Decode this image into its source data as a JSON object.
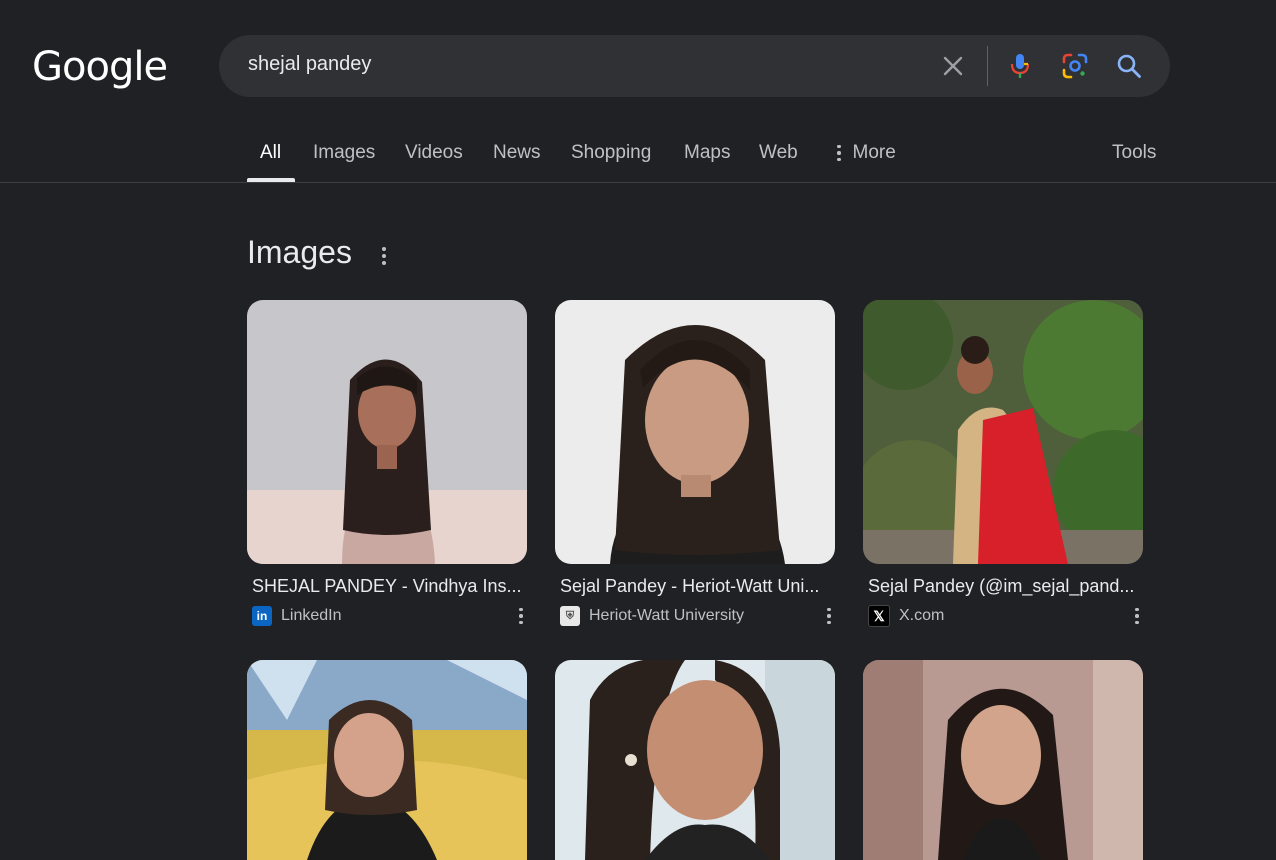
{
  "logo": "Google",
  "search": {
    "query": "shejal pandey"
  },
  "tabs": [
    {
      "label": "All",
      "active": true
    },
    {
      "label": "Images"
    },
    {
      "label": "Videos"
    },
    {
      "label": "News"
    },
    {
      "label": "Shopping"
    },
    {
      "label": "Maps"
    },
    {
      "label": "Web"
    },
    {
      "label": "More"
    }
  ],
  "tools_label": "Tools",
  "section": {
    "title": "Images"
  },
  "results": [
    {
      "title": "SHEJAL PANDEY - Vindhya Ins...",
      "source": "LinkedIn",
      "favicon": "linkedin-icon"
    },
    {
      "title": "Sejal Pandey - Heriot-Watt Uni...",
      "source": "Heriot-Watt University",
      "favicon": "heriot-watt-crest-icon"
    },
    {
      "title": "Sejal Pandey (@im_sejal_pand...",
      "source": "X.com",
      "favicon": "x-icon"
    },
    {
      "title": "",
      "source": "",
      "favicon": ""
    },
    {
      "title": "",
      "source": "",
      "favicon": ""
    },
    {
      "title": "",
      "source": "",
      "favicon": ""
    }
  ],
  "colors": {
    "background": "#202124",
    "searchbar": "#303134",
    "text": "#e8eaed",
    "muted": "#bdc1c6"
  }
}
